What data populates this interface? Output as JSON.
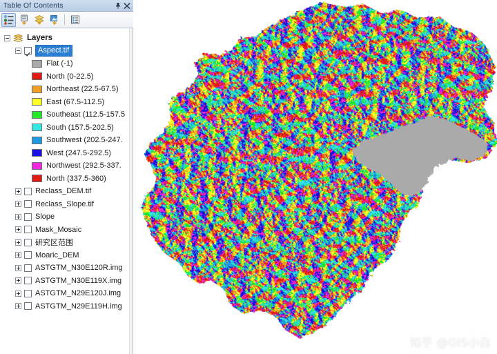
{
  "panel": {
    "title": "Table Of Contents",
    "pin_icon": "pushpin-icon",
    "close_icon": "close-icon",
    "toolbar": [
      {
        "name": "list-by-drawing-order-button",
        "selected": true
      },
      {
        "name": "list-by-source-button",
        "selected": false
      },
      {
        "name": "list-by-visibility-button",
        "selected": false
      },
      {
        "name": "list-by-selection-button",
        "selected": false
      },
      {
        "name": "options-button",
        "selected": false
      }
    ]
  },
  "tree": {
    "root": {
      "label": "Layers",
      "icon": "layers-icon",
      "expanded": true
    },
    "active_layer": {
      "label": "Aspect.tif",
      "checked": true,
      "expanded": true,
      "selected": true
    },
    "legend": [
      {
        "label": "Flat (-1)",
        "color": "#aaaaaa"
      },
      {
        "label": "North (0-22.5)",
        "color": "#e01b14"
      },
      {
        "label": "Northeast (22.5-67.5)",
        "color": "#f0a021"
      },
      {
        "label": "East (67.5-112.5)",
        "color": "#ffff28"
      },
      {
        "label": "Southeast (112.5-157.5",
        "color": "#22e829"
      },
      {
        "label": "South (157.5-202.5)",
        "color": "#33e8e0"
      },
      {
        "label": "Southwest (202.5-247.",
        "color": "#1e9be0"
      },
      {
        "label": "West (247.5-292.5)",
        "color": "#1b10e0"
      },
      {
        "label": "Northwest (292.5-337.",
        "color": "#f027e0"
      },
      {
        "label": "North (337.5-360)",
        "color": "#e01b14"
      }
    ],
    "layers": [
      {
        "label": "Reclass_DEM.tif",
        "checked": false
      },
      {
        "label": "Reclass_Slope.tif",
        "checked": false
      },
      {
        "label": "Slope",
        "checked": false
      },
      {
        "label": "Mask_Mosaic",
        "checked": false
      },
      {
        "label": "研究区范围",
        "checked": false
      },
      {
        "label": "Moaric_DEM",
        "checked": false
      },
      {
        "label": "ASTGTM_N30E120R.img",
        "checked": false
      },
      {
        "label": "ASTGTM_N30E119X.img",
        "checked": false
      },
      {
        "label": "ASTGTM_N29E120J.img",
        "checked": false
      },
      {
        "label": "ASTGTM_N29E119H.img",
        "checked": false
      }
    ]
  },
  "map": {
    "background": "#ffffff",
    "flat_color": "#aaaaaa",
    "watermark": "知乎 @GIS小白",
    "aspect_palette": [
      "#e01b14",
      "#f0a021",
      "#ffff28",
      "#22e829",
      "#33e8e0",
      "#1e9be0",
      "#1b10e0",
      "#f027e0"
    ]
  }
}
